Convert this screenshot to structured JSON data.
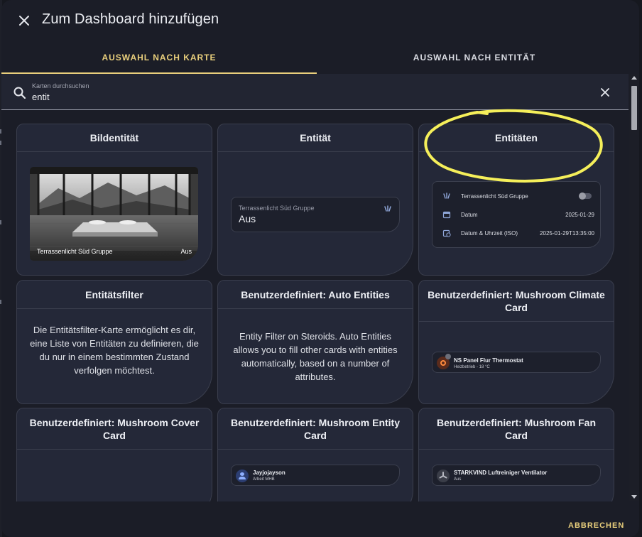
{
  "dialog": {
    "title": "Zum Dashboard hinzufügen",
    "close_icon": "close-icon",
    "cancel_label": "ABBRECHEN"
  },
  "tabs": [
    {
      "label": "AUSWAHL NACH KARTE",
      "active": true
    },
    {
      "label": "AUSWAHL NACH ENTITÄT",
      "active": false
    }
  ],
  "search": {
    "label": "Karten durchsuchen",
    "value": "entit",
    "icon": "search-icon",
    "clear_icon": "close-icon"
  },
  "colors": {
    "accent": "#e9cf7c",
    "highlight_stroke": "#f5ef5a",
    "card_bg": "#242838",
    "dialog_bg": "#1b1d27"
  },
  "cards": {
    "bildentitaet": {
      "title": "Bildentität",
      "caption": "Terrassenlicht Süd Gruppe",
      "state": "Aus"
    },
    "entitaet": {
      "title": "Entität",
      "name": "Terrassenlicht Süd Gruppe",
      "state": "Aus",
      "icon": "light-group-icon"
    },
    "entitaeten": {
      "title": "Entitäten",
      "rows": [
        {
          "label": "Terrassenlicht Süd Gruppe",
          "value": "",
          "icon": "light-group-icon",
          "toggle": false
        },
        {
          "label": "Datum",
          "value": "2025-01-29",
          "icon": "calendar-icon"
        },
        {
          "label": "Datum & Uhrzeit (ISO)",
          "value": "2025-01-29T13:35:00",
          "icon": "calendar-clock-icon"
        }
      ]
    },
    "entitaetsfilter": {
      "title": "Entitätsfilter",
      "description": "Die Entitätsfilter-Karte ermöglicht es dir, eine Liste von Entitäten zu definieren, die du nur in einem bestimmten Zustand verfolgen möchtest."
    },
    "auto_entities": {
      "title": "Benutzerdefiniert: Auto Entities",
      "description": "Entity Filter on Steroids. Auto Entities allows you to fill other cards with entities automatically, based on a number of attributes."
    },
    "mushroom_climate": {
      "title": "Benutzerdefiniert: Mushroom Climate Card",
      "name": "NS Panel Flur Thermostat",
      "sub": "Heizbetrieb - 18 °C",
      "icon": "thermostat-icon"
    },
    "mushroom_cover": {
      "title": "Benutzerdefiniert: Mushroom Cover Card"
    },
    "mushroom_entity": {
      "title": "Benutzerdefiniert: Mushroom Entity Card",
      "name": "Jayjojayson",
      "sub": "Arbeit MHB",
      "icon": "person-icon"
    },
    "mushroom_fan": {
      "title": "Benutzerdefiniert: Mushroom Fan Card",
      "name": "STARKVIND Luftreiniger Ventilator",
      "sub": "Aus",
      "icon": "fan-icon"
    }
  }
}
